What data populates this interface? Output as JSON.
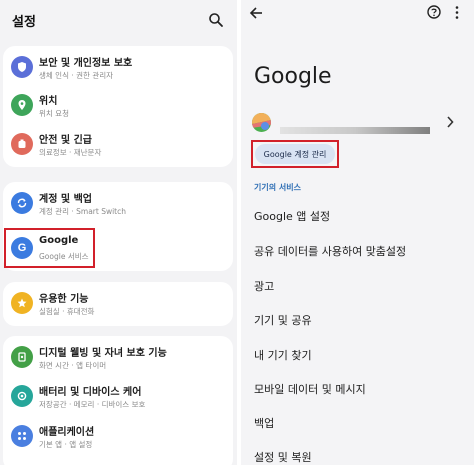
{
  "left": {
    "title": "설정",
    "items": [
      {
        "title": "보안 및 개인정보 보호",
        "subtitle": "생체 인식  ·  권한 관리자",
        "color": "#5b6fd8",
        "icon": "shield-icon"
      },
      {
        "title": "위치",
        "subtitle": "위치 요청",
        "color": "#3ea55a",
        "icon": "location-pin-icon"
      },
      {
        "title": "안전 및 긴급",
        "subtitle": "의료정보  ·  재난문자",
        "color": "#e06a5c",
        "icon": "emergency-icon"
      },
      {
        "title": "계정 및 백업",
        "subtitle": "계정 관리  ·  Smart Switch",
        "color": "#3b7be0",
        "icon": "sync-icon"
      },
      {
        "title": "Google",
        "subtitle": "Google 서비스",
        "color": "#3b7be0",
        "icon": "google-icon"
      },
      {
        "title": "유용한 기능",
        "subtitle": "실험실  ·  휴대전화",
        "color": "#f0b323",
        "icon": "star-icon"
      },
      {
        "title": "디지털 웰빙 및 자녀 보호 기능",
        "subtitle": "화면 시간  ·  앱 타이머",
        "color": "#43a047",
        "icon": "wellbeing-icon"
      },
      {
        "title": "배터리 및 디바이스 케어",
        "subtitle": "저장공간  ·  메모리  ·  디바이스 보호",
        "color": "#26a69a",
        "icon": "device-care-icon"
      },
      {
        "title": "애플리케이션",
        "subtitle": "기본 앱  ·  앱 설정",
        "color": "#4a7fe0",
        "icon": "apps-icon"
      }
    ]
  },
  "right": {
    "title": "Google",
    "account_button": "Google 계정 관리",
    "section_label": "기기의 서비스",
    "items": [
      "Google 앱 설정",
      "공유 데이터를 사용하여 맞춤설정",
      "광고",
      "기기 및 공유",
      "내 기기 찾기",
      "모바일 데이터 및 메시지",
      "백업",
      "설정 및 복원"
    ]
  },
  "colors": {
    "highlight": "#d2202a",
    "accent_blue": "#2f6fb5",
    "account_button_bg": "#d9e3f3"
  }
}
